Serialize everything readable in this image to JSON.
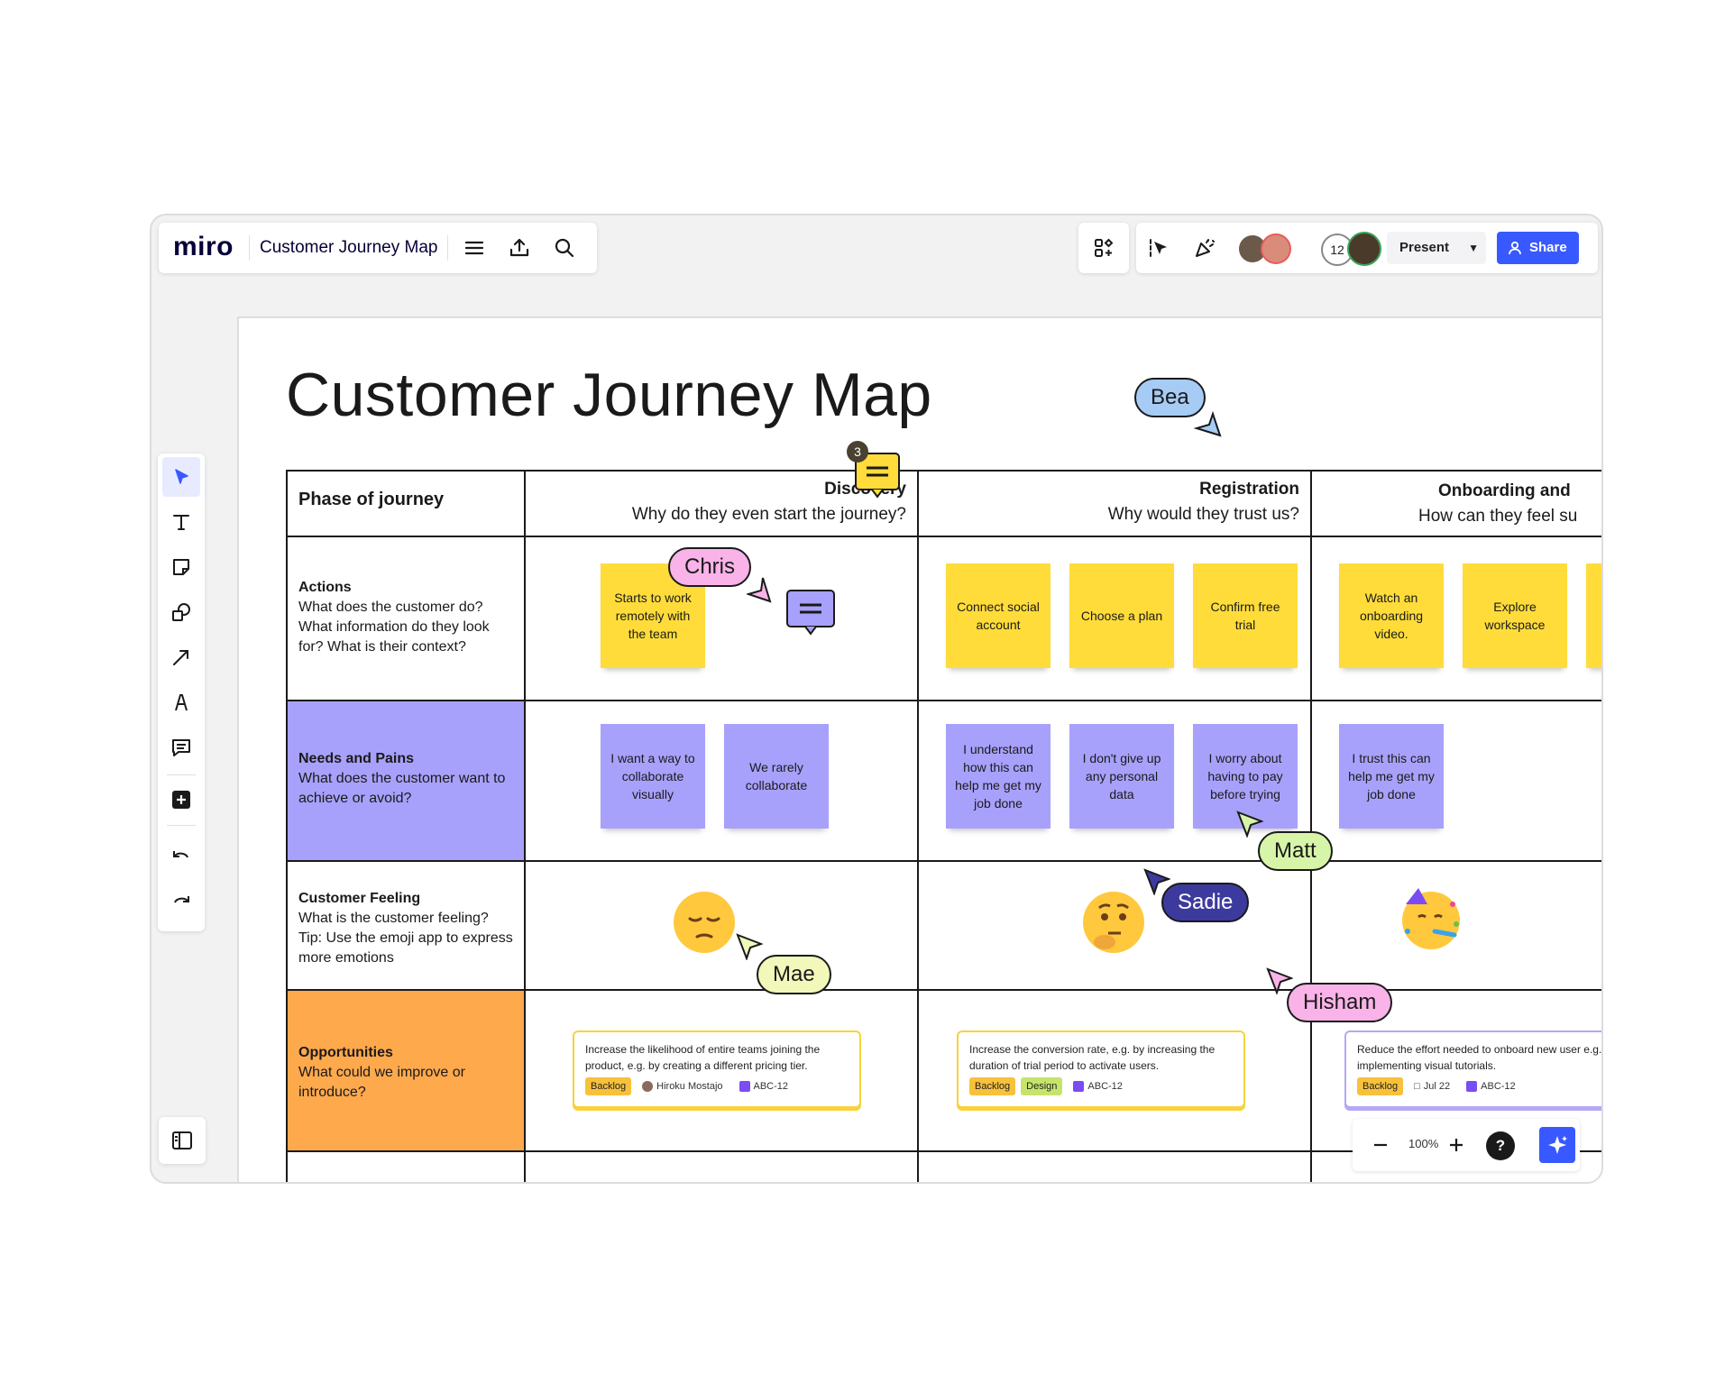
{
  "topbar": {
    "logo": "miro",
    "board_name": "Customer Journey Map",
    "collaborator_count": "12",
    "present_label": "Present",
    "share_label": "Share"
  },
  "board": {
    "title": "Customer Journey Map",
    "phase_header": "Phase of journey",
    "phases": [
      {
        "name": "Discovery",
        "question": "Why do they even start the journey?"
      },
      {
        "name": "Registration",
        "question": "Why would they trust us?"
      },
      {
        "name": "Onboarding and",
        "question": "How can they feel su"
      }
    ],
    "rows": [
      {
        "title": "Actions",
        "desc": "What does the customer do? What information do they look for? What is their context?"
      },
      {
        "title": "Needs and Pains",
        "desc": "What does the customer want to achieve or avoid?"
      },
      {
        "title": "Customer Feeling",
        "desc": "What is the customer feeling? Tip: Use the emoji app to express more emotions"
      },
      {
        "title": "Opportunities",
        "desc": "What could we improve or introduce?"
      }
    ],
    "actions_stickies": [
      "Starts to work remotely with the team",
      "Connect social account",
      "Choose a plan",
      "Confirm free trial",
      "Watch an onboarding video.",
      "Explore workspace"
    ],
    "needs_stickies": [
      "I want a way to collaborate visually",
      "We rarely collaborate",
      "I understand how this can help me get my job done",
      "I don't give up any personal data",
      "I worry about having to pay before trying",
      "I trust this can help me get my job done"
    ],
    "feelings": [
      "pensive-face",
      "thinking-face",
      "partying-face"
    ],
    "cards": [
      {
        "text": "Increase the likelihood of entire teams joining the product, e.g. by creating a different pricing tier.",
        "tags": [
          "Backlog"
        ],
        "assignee": "Hiroku Mostajo",
        "issue": "ABC-12"
      },
      {
        "text": "Increase the conversion rate, e.g. by increasing the duration of trial period to activate users.",
        "tags": [
          "Backlog",
          "Design"
        ],
        "issue": "ABC-12"
      },
      {
        "text": "Reduce the effort needed to onboard new user e.g. by implementing visual tutorials.",
        "tags": [
          "Backlog"
        ],
        "date": "Jul 22",
        "issue": "ABC-12"
      }
    ],
    "comment_count": "3"
  },
  "cursors": [
    {
      "name": "Bea",
      "color": "#a6ccf5"
    },
    {
      "name": "Chris",
      "color": "#f9b3e8"
    },
    {
      "name": "Matt",
      "color": "#d7f5a8"
    },
    {
      "name": "Sadie",
      "color": "#3d3a9e"
    },
    {
      "name": "Mae",
      "color": "#f2f7ba"
    },
    {
      "name": "Hisham",
      "color": "#f9b3e8"
    }
  ],
  "zoom": {
    "level": "100%"
  },
  "colors": {
    "accent": "#3859ff",
    "sticky_yellow": "#ffdc3a",
    "sticky_purple": "#a8a1fb",
    "needs_row": "#a8a1fb",
    "opportunities_row": "#ffa94d"
  }
}
